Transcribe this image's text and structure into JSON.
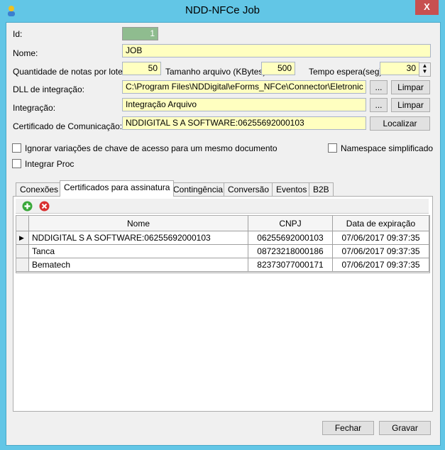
{
  "window": {
    "title": "NDD-NFCe Job",
    "close": "X"
  },
  "form": {
    "id_label": "Id:",
    "id_value": "1",
    "nome_label": "Nome:",
    "nome_value": "JOB",
    "qtd_label": "Quantidade de notas por lote:",
    "qtd_value": "50",
    "tam_label": "Tamanho arquivo (KBytes):",
    "tam_value": "500",
    "tempo_label": "Tempo espera(seg):",
    "tempo_value": "30",
    "dll_label": "DLL de integração:",
    "dll_value": "C:\\Program Files\\NDDigital\\eForms_NFCe\\Connector\\Eletronic Co",
    "integ_label": "Integração:",
    "integ_value": "Integração Arquivo",
    "cert_label": "Certificado de Comunicação:",
    "cert_value": "NDDIGITAL S A SOFTWARE:06255692000103",
    "browse": "...",
    "limpar": "Limpar",
    "localizar": "Localizar",
    "ignorar": "Ignorar variações de chave de acesso para um mesmo documento",
    "namespace": "Namespace simplificado",
    "integrar_proc": "Integrar Proc"
  },
  "tabs": [
    "Conexões",
    "Certificados para assinatura",
    "Contingência",
    "Conversão",
    "Eventos",
    "B2B"
  ],
  "grid": {
    "columns": [
      "Nome",
      "CNPJ",
      "Data de expiração"
    ],
    "rows": [
      [
        "NDDIGITAL S A SOFTWARE:06255692000103",
        "06255692000103",
        "07/06/2017 09:37:35"
      ],
      [
        "Tanca",
        "08723218000186",
        "07/06/2017 09:37:35"
      ],
      [
        "Bematech",
        "82373077000171",
        "07/06/2017 09:37:35"
      ]
    ]
  },
  "footer": {
    "fechar": "Fechar",
    "gravar": "Gravar"
  }
}
